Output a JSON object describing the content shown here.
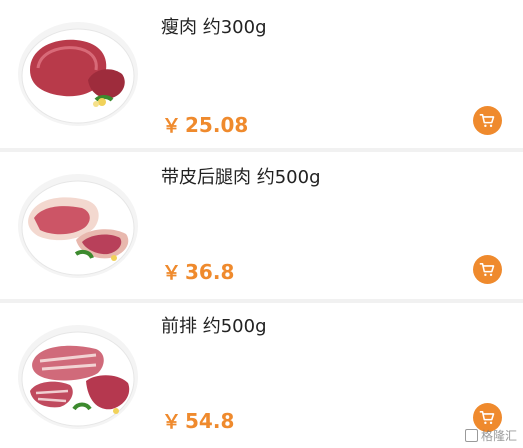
{
  "products": [
    {
      "name": "瘦肉 约300g",
      "price_symbol": "￥",
      "price": "25.08",
      "image": "lean-pork-image",
      "cart_icon": "cart-icon"
    },
    {
      "name": "带皮后腿肉 约500g",
      "price_symbol": "￥",
      "price": "36.8",
      "image": "pork-hind-leg-image",
      "cart_icon": "cart-icon"
    },
    {
      "name": "前排 约500g",
      "price_symbol": "￥",
      "price": "54.8",
      "image": "pork-ribs-image",
      "cart_icon": "cart-icon"
    }
  ],
  "watermark": {
    "text": "格隆汇"
  },
  "colors": {
    "accent": "#ef8a2d",
    "background": "#f1f1f1",
    "card": "#ffffff",
    "title": "#222222"
  }
}
